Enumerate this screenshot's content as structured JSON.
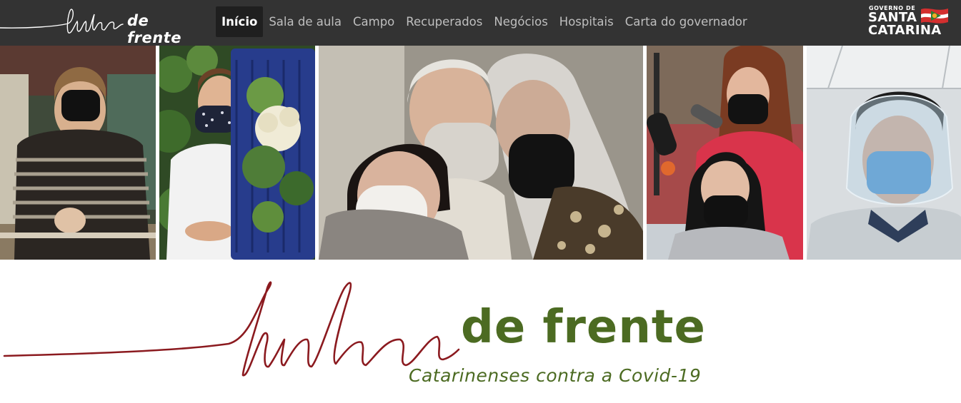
{
  "brand": {
    "script_text": "linha",
    "word_text": "de frente",
    "script_color": "#8b1a1f",
    "word_color": "#4c6b22"
  },
  "nav": {
    "items": [
      {
        "label": "Início",
        "active": true
      },
      {
        "label": "Sala de aula",
        "active": false
      },
      {
        "label": "Campo",
        "active": false
      },
      {
        "label": "Recuperados",
        "active": false
      },
      {
        "label": "Negócios",
        "active": false
      },
      {
        "label": "Hospitais",
        "active": false
      },
      {
        "label": "Carta do governador",
        "active": false
      }
    ]
  },
  "gov_logo": {
    "line1": "GOVERNO DE",
    "line2": "SANTA",
    "line3": "CATARINA"
  },
  "photos": [
    {
      "subject": "woman in black mask with striped sweater"
    },
    {
      "subject": "young man in patterned mask with vegetable crate"
    },
    {
      "subject": "family of three wearing masks"
    },
    {
      "subject": "hairdresser and client wearing masks"
    },
    {
      "subject": "health worker with face shield and surgical mask"
    }
  ],
  "hero": {
    "tagline": "Catarinenses contra a Covid-19"
  },
  "colors": {
    "navbar": "#333333",
    "nav_active_bg": "#1f1f1f",
    "script_red": "#8b1a1f",
    "brand_green": "#4c6b22"
  }
}
